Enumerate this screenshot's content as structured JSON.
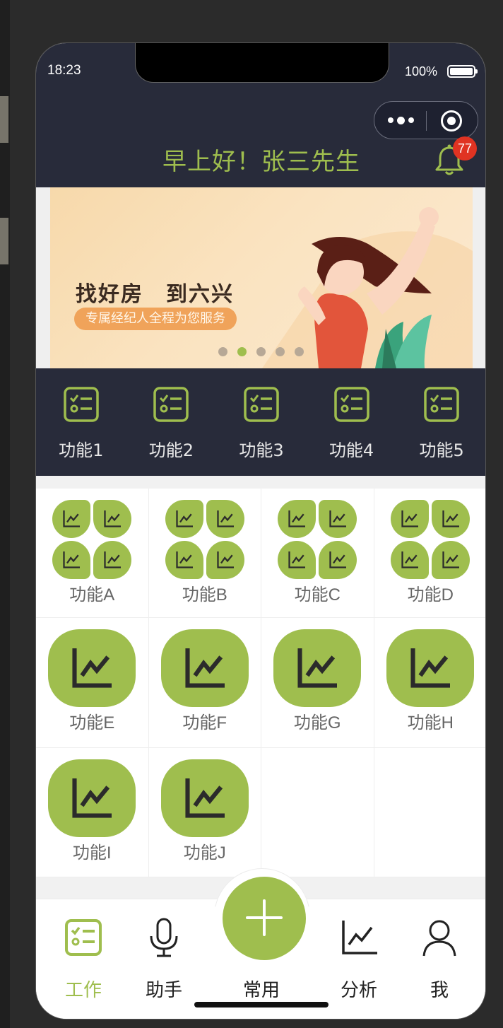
{
  "status": {
    "time": "18:23",
    "battery": "100%"
  },
  "header": {
    "greeting": "早上好！张三先生",
    "notification_count": "77"
  },
  "banner": {
    "title": "找好房　到六兴",
    "subtitle": "专属经纪人全程为您服务",
    "pages": 5,
    "active_page": 2
  },
  "quick_functions": [
    {
      "label": "功能1",
      "icon": "checklist-icon"
    },
    {
      "label": "功能2",
      "icon": "checklist-icon"
    },
    {
      "label": "功能3",
      "icon": "checklist-icon"
    },
    {
      "label": "功能4",
      "icon": "checklist-icon"
    },
    {
      "label": "功能5",
      "icon": "checklist-icon"
    }
  ],
  "grid": {
    "clover_items": [
      {
        "label": "功能A"
      },
      {
        "label": "功能B"
      },
      {
        "label": "功能C"
      },
      {
        "label": "功能D"
      }
    ],
    "tile_items": [
      {
        "label": "功能E"
      },
      {
        "label": "功能F"
      },
      {
        "label": "功能G"
      },
      {
        "label": "功能H"
      },
      {
        "label": "功能I"
      },
      {
        "label": "功能J"
      }
    ]
  },
  "tabbar": {
    "items": [
      {
        "label": "工作",
        "icon": "checklist-icon",
        "active": true
      },
      {
        "label": "助手",
        "icon": "microphone-icon"
      },
      {
        "label": "常用",
        "icon": "plus-icon"
      },
      {
        "label": "分析",
        "icon": "chart-icon"
      },
      {
        "label": "我",
        "icon": "user-icon"
      }
    ]
  },
  "colors": {
    "accent": "#9fbe4e",
    "header_bg": "#282b3a",
    "badge": "#e03322"
  }
}
